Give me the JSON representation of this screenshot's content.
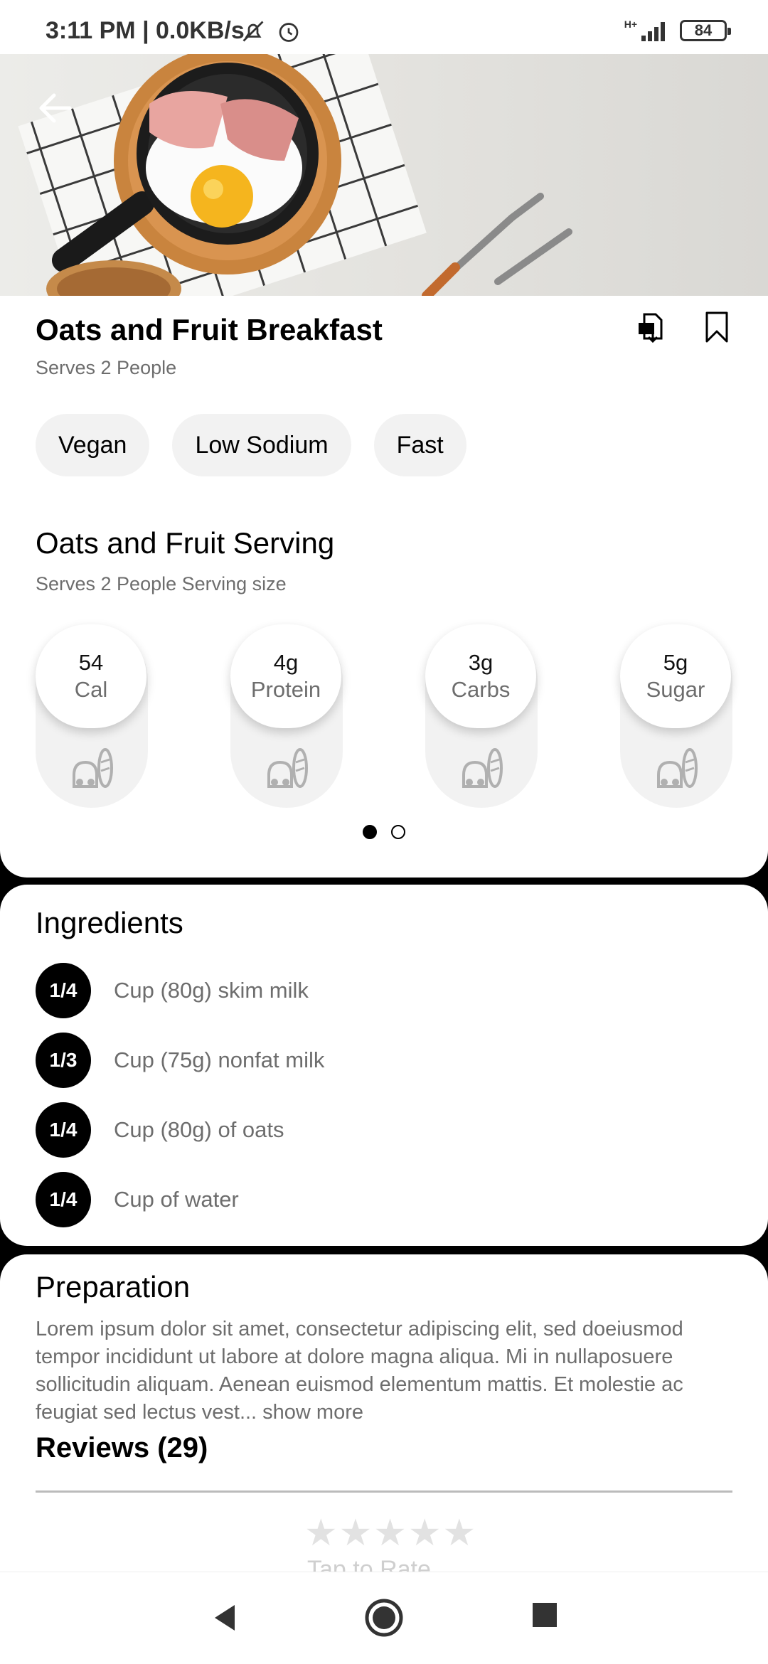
{
  "status_bar": {
    "time": "3:11 PM | 0.0KB/s",
    "battery": "84",
    "network": "H+"
  },
  "recipe": {
    "title": "Oats and Fruit Breakfast",
    "serves": "Serves 2 People"
  },
  "tags": [
    "Vegan",
    "Low Sodium",
    "Fast"
  ],
  "serving": {
    "title": "Oats and Fruit Serving",
    "subtitle": "Serves 2 People Serving size",
    "nutrients": [
      {
        "value": "54",
        "label": "Cal"
      },
      {
        "value": "4g",
        "label": "Protein"
      },
      {
        "value": "3g",
        "label": "Carbs"
      },
      {
        "value": "5g",
        "label": "Sugar"
      }
    ]
  },
  "ingredients": {
    "title": "Ingredients",
    "items": [
      {
        "qty": "1/4",
        "text": "Cup (80g) skim milk"
      },
      {
        "qty": "1/3",
        "text": "Cup (75g) nonfat milk"
      },
      {
        "qty": "1/4",
        "text": "Cup (80g) of oats"
      },
      {
        "qty": "1/4",
        "text": "Cup of water"
      }
    ]
  },
  "preparation": {
    "title": "Preparation",
    "body": "Lorem ipsum dolor sit amet, consectetur adipiscing elit, sed doeiusmod tempor incididunt ut labore at dolore magna aliqua. Mi in nullaposuere sollicitudin aliquam. Aenean euismod elementum mattis. Et molestie ac feugiat sed lectus vest... show more"
  },
  "reviews": {
    "title": "Reviews (29)",
    "stars": "★★★★★",
    "tap_to_rate": "Tap to Rate"
  },
  "colors": {
    "accent": "#000000",
    "muted_text": "#6d6d6d",
    "chip_bg": "#f2f2f2"
  }
}
